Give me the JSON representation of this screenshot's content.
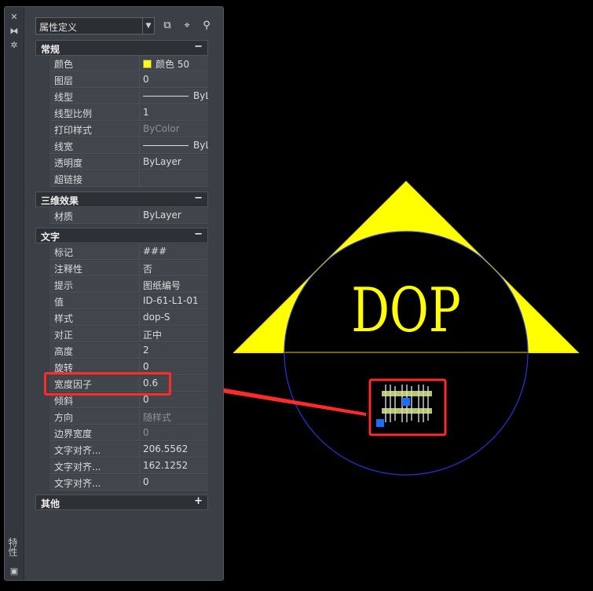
{
  "palette": {
    "title_vertical": "特性",
    "selector": "属性定义",
    "sections": {
      "general": {
        "title": "常规",
        "rows": [
          {
            "label": "颜色",
            "value": "颜色 50"
          },
          {
            "label": "图层",
            "value": "0"
          },
          {
            "label": "线型",
            "value": "ByLayer"
          },
          {
            "label": "线型比例",
            "value": "1"
          },
          {
            "label": "打印样式",
            "value": "ByColor"
          },
          {
            "label": "线宽",
            "value": "ByLayer"
          },
          {
            "label": "透明度",
            "value": "ByLayer"
          },
          {
            "label": "超链接",
            "value": ""
          }
        ]
      },
      "three_d": {
        "title": "三维效果",
        "rows": [
          {
            "label": "材质",
            "value": "ByLayer"
          }
        ]
      },
      "text": {
        "title": "文字",
        "rows": [
          {
            "label": "标记",
            "value": "###"
          },
          {
            "label": "注释性",
            "value": "否"
          },
          {
            "label": "提示",
            "value": "图纸编号"
          },
          {
            "label": "值",
            "value": "ID-61-L1-01"
          },
          {
            "label": "样式",
            "value": "dop-S"
          },
          {
            "label": "对正",
            "value": "正中"
          },
          {
            "label": "高度",
            "value": "2"
          },
          {
            "label": "旋转",
            "value": "0"
          },
          {
            "label": "宽度因子",
            "value": "0.6"
          },
          {
            "label": "倾斜",
            "value": "0"
          },
          {
            "label": "方向",
            "value": "随样式"
          },
          {
            "label": "边界宽度",
            "value": "0"
          },
          {
            "label": "文字对齐...",
            "value": "206.5562"
          },
          {
            "label": "文字对齐...",
            "value": "162.1252"
          },
          {
            "label": "文字对齐...",
            "value": "0"
          }
        ]
      },
      "other": {
        "title": "其他"
      }
    },
    "toggle_collapse": "−",
    "toggle_expand": "+"
  },
  "drawing": {
    "title_text": "DOP",
    "colors": {
      "triangle": "#ffff00",
      "circle": "#2233cc",
      "highlight": "#ff2a2a",
      "grip": "#1a6dff"
    }
  }
}
